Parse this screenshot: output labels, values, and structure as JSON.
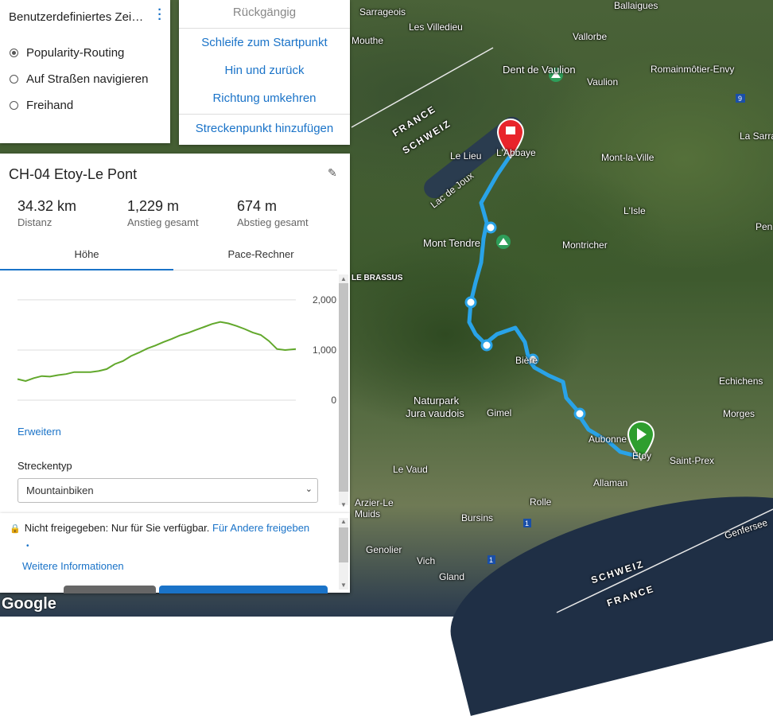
{
  "colors": {
    "accent": "#1a73c8",
    "route": "#29a3e8",
    "elevation": "#62a82c",
    "start_marker": "#2e9e2e",
    "end_marker": "#e8242b"
  },
  "map": {
    "labels": [
      "Sarrageois",
      "Les Villedieu",
      "Ballaigues",
      "Vallorbe",
      "Mouthe",
      "Dent de Vaulion",
      "Vaulion",
      "Romainmôtier-Envy",
      "La Sarraz",
      "FRANCE",
      "SCHWEIZ",
      "Le Lieu",
      "L'Abbaye",
      "Mont-la-Ville",
      "Lac de Joux",
      "L'Isle",
      "Pen",
      "Mont Tendre",
      "Montricher",
      "LE BRASSUS",
      "Bière",
      "Echichens",
      "Naturpark",
      "Jura vaudois",
      "Gimel",
      "Morges",
      "Aubonne",
      "Etoy",
      "Saint-Prex",
      "Le Vaud",
      "Allaman",
      "Arzier-Le Muids",
      "Rolle",
      "Bursins",
      "Genolier",
      "Vich",
      "Gland",
      "Genfersee",
      "SCHWEIZ",
      "FRANCE"
    ],
    "highway_badges": [
      "9",
      "1",
      "1"
    ],
    "google": "Google"
  },
  "mode_panel": {
    "title": "Benutzerdefiniertes Zei…",
    "options": [
      {
        "label": "Popularity-Routing",
        "selected": true
      },
      {
        "label": "Auf Straßen navigieren",
        "selected": false
      },
      {
        "label": "Freihand",
        "selected": false
      }
    ]
  },
  "menu": {
    "undo": "Rückgängig",
    "items": [
      "Schleife zum Startpunkt",
      "Hin und zurück",
      "Richtung umkehren",
      "Streckenpunkt hinzufügen"
    ]
  },
  "route": {
    "title": "CH-04 Etoy-Le Pont",
    "stats": [
      {
        "value": "34.32 km",
        "label": "Distanz"
      },
      {
        "value": "1,229 m",
        "label": "Anstieg gesamt"
      },
      {
        "value": "674 m",
        "label": "Abstieg gesamt"
      }
    ],
    "tabs": [
      "Höhe",
      "Pace-Rechner"
    ],
    "expand": "Erweitern",
    "route_type_label": "Streckentyp",
    "route_type_value": "Mountainbiken"
  },
  "chart_data": {
    "type": "area",
    "y_ticks": [
      "2,000",
      "1,000",
      "0"
    ],
    "ylim": [
      0,
      2300
    ],
    "x": [
      0,
      1,
      2,
      3,
      4,
      5,
      6,
      7,
      8,
      9,
      10,
      11,
      12,
      13,
      14,
      15,
      16,
      17,
      18,
      19,
      20,
      21,
      22,
      23,
      24,
      25,
      26,
      27,
      28,
      29,
      30,
      31,
      32,
      33,
      34.32
    ],
    "values": [
      420,
      380,
      440,
      480,
      470,
      500,
      520,
      560,
      560,
      560,
      580,
      620,
      720,
      780,
      880,
      950,
      1030,
      1090,
      1160,
      1220,
      1290,
      1340,
      1400,
      1460,
      1520,
      1560,
      1530,
      1480,
      1420,
      1350,
      1300,
      1180,
      1020,
      1000,
      1020
    ]
  },
  "share": {
    "text": "Nicht freigegeben: Nur für Sie verfügbar.",
    "link": "Für Andere freigeben",
    "more": "Weitere Informationen"
  }
}
